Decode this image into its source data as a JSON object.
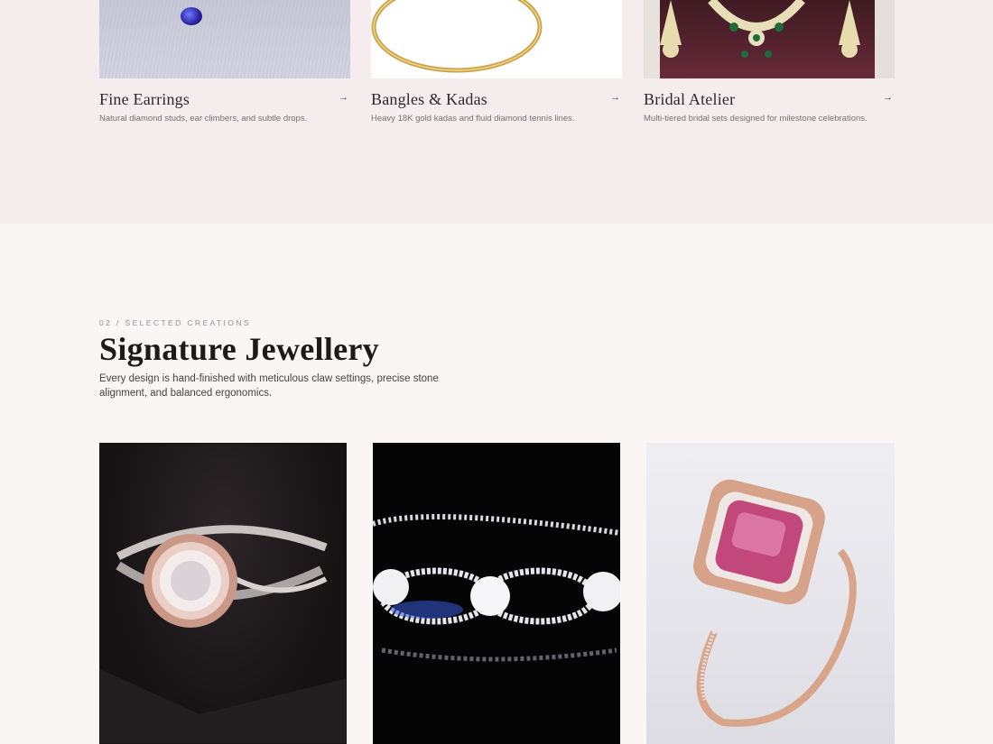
{
  "categories": [
    {
      "title": "Fine Earrings",
      "description": "Natural diamond studs, ear climbers, and subtle drops.",
      "arrow": "→",
      "image": "blue-sapphire-earring-image"
    },
    {
      "title": "Bangles & Kadas",
      "description": "Heavy 18K gold kadas and fluid diamond tennis lines.",
      "arrow": "→",
      "image": "gold-bangle-image"
    },
    {
      "title": "Bridal Atelier",
      "description": "Multi-tiered bridal sets designed for milestone celebrations.",
      "arrow": "→",
      "image": "bridal-necklace-set-image"
    }
  ],
  "signature": {
    "eyebrow": "02 / SELECTED CREATIONS",
    "title": "Signature Jewellery",
    "description": "Every design is hand-finished with meticulous claw settings, precise stone alignment, and balanced ergonomics."
  },
  "products": [
    {
      "image": "rose-gold-halo-diamond-ring-image"
    },
    {
      "image": "diamond-link-bracelet-image"
    },
    {
      "image": "pink-sapphire-halo-ring-image"
    }
  ],
  "colors": {
    "category_bg": "#f5eded",
    "page_bg": "#faf6f5",
    "heading": "#1f1a1a",
    "muted": "#7b6f6f"
  }
}
